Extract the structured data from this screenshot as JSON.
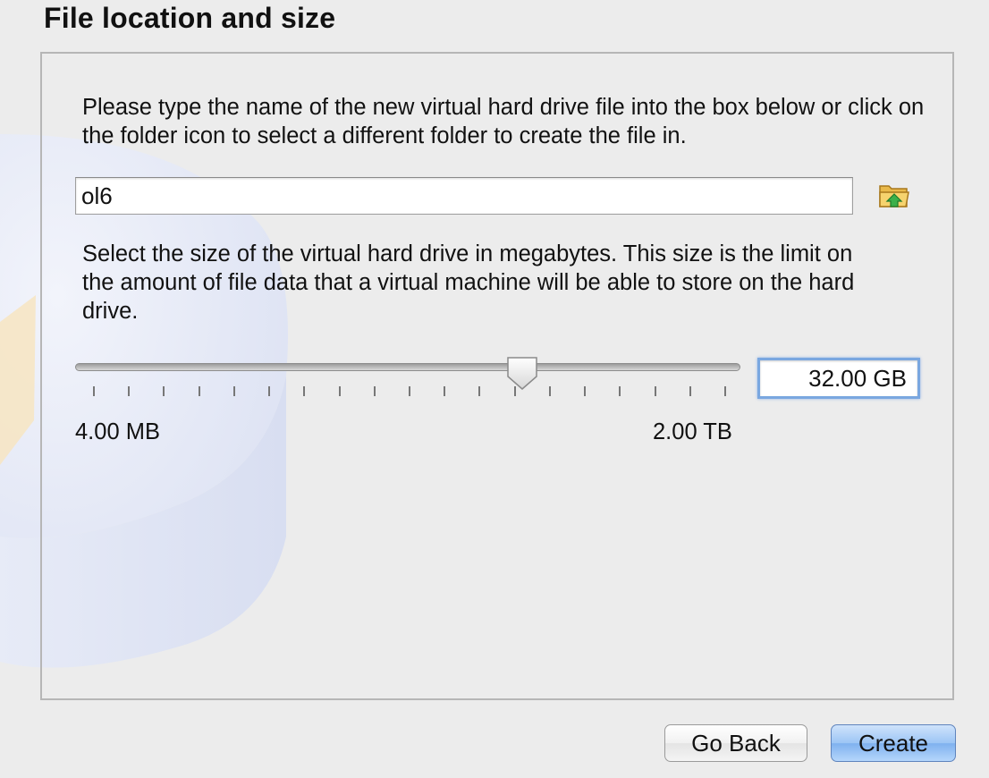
{
  "page": {
    "title": "File location and size"
  },
  "location": {
    "description": "Please type the name of the new virtual hard drive file into the box below or click on the folder icon to select a different folder to create the file in.",
    "file_name_value": "ol6",
    "folder_button_icon": "folder-open-icon"
  },
  "size": {
    "description": "Select the size of the virtual hard drive in megabytes. This size is the limit on the amount of file data that a virtual machine will be able to store on the hard drive.",
    "value": "32.00 GB",
    "slider_fraction": 0.672,
    "tick_count": 19,
    "min_label": "4.00 MB",
    "max_label": "2.00 TB"
  },
  "buttons": {
    "back_label": "Go Back",
    "create_label": "Create"
  },
  "colors": {
    "primary_button": "#8fbdf3",
    "focus_ring": "#7aa7e0",
    "window_bg": "#ececec"
  }
}
